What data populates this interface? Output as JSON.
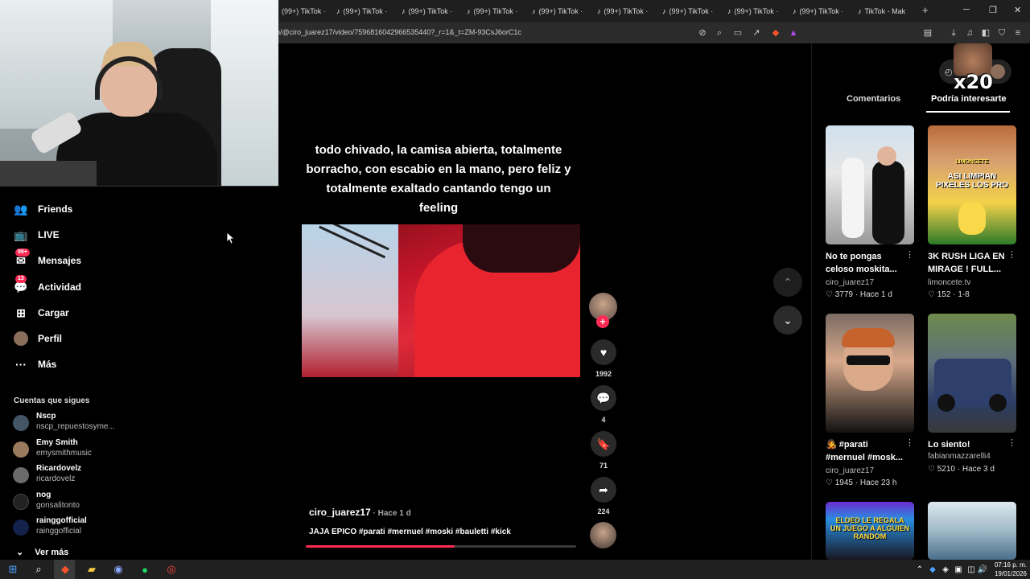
{
  "browser": {
    "tabs": [
      {
        "label": "(99+) TikTok ·"
      },
      {
        "label": "(99+) TikTok ·"
      },
      {
        "label": "(99+) TikTok ·"
      },
      {
        "label": "(99+) TikTok ·"
      },
      {
        "label": "(99+) TikTok ·"
      },
      {
        "label": "(99+) TikTok ·"
      },
      {
        "label": "(99+) TikTok ·"
      },
      {
        "label": "(99+) TikTok ·"
      },
      {
        "label": "(99+) TikTok ·"
      },
      {
        "label": "TikTok - Mak"
      }
    ],
    "url": "n/@ciro_juarez17/video/7596816042966535440?_r=1&_t=ZM-93CsJ6orC1c"
  },
  "sidebar": {
    "items": [
      {
        "label": "Friends",
        "icon": "friends-icon"
      },
      {
        "label": "LIVE",
        "icon": "live-icon"
      },
      {
        "label": "Mensajes",
        "icon": "messages-icon",
        "badge": "99+"
      },
      {
        "label": "Actividad",
        "icon": "activity-icon",
        "badge": "13"
      },
      {
        "label": "Cargar",
        "icon": "upload-icon"
      },
      {
        "label": "Perfil",
        "icon": "profile-avatar"
      },
      {
        "label": "Más",
        "icon": "more-icon"
      }
    ],
    "following_title": "Cuentas que sigues",
    "following": [
      {
        "name": "Nscp",
        "handle": "nscp_repuestosyme..."
      },
      {
        "name": "Emy Smith",
        "handle": "emysmithmusic"
      },
      {
        "name": "Ricardovelz",
        "handle": "ricardovelz"
      },
      {
        "name": "nog",
        "handle": "gonsalitonto"
      },
      {
        "name": "rainggofficial",
        "handle": "rainggofficial"
      }
    ],
    "see_more": "Ver más"
  },
  "video": {
    "caption": "todo chivado, la camisa abierta, totalmente borracho, con escabio en la mano, pero feliz y totalmente exaltado cantando tengo un feeling",
    "author": "ciro_juarez17",
    "time": " · Hace 1 d",
    "description": "JAJA EPICO #parati #mernuel #moski #bauletti #kick",
    "progress": 0.55,
    "likes": "1992",
    "comments": "4",
    "saves": "71",
    "shares": "224"
  },
  "right_panel": {
    "x20_label": "x20",
    "tabs": [
      {
        "label": "Comentarios"
      },
      {
        "label": "Podría interesarte"
      }
    ],
    "cards": [
      {
        "title": "No te pongas celoso moskita...",
        "author": "ciro_juarez17",
        "stats": "♡ 3779 · Hace 1 d",
        "thumb_text": ""
      },
      {
        "title": "3K RUSH LIGA EN MIRAGE ! FULL...",
        "author": "limoncete.tv",
        "stats": "♡ 152 · 1-8",
        "thumb_text": "ASI LIMPIAN PIXELES LOS PRO"
      },
      {
        "title": "🧑‍🎤 #parati #mernuel #mosk...",
        "author": "ciro_juarez17",
        "stats": "♡ 1945 · Hace 23 h",
        "thumb_text": ""
      },
      {
        "title": "Lo siento!",
        "author": "fabianmazzarelli4",
        "stats": "♡ 5210 · Hace 3 d",
        "thumb_text": ""
      },
      {
        "title": "",
        "author": "",
        "stats": "",
        "thumb_text": "ELDED LE REGALA UN JUEGO A ALGUIEN RANDOM"
      },
      {
        "title": "",
        "author": "",
        "stats": "",
        "thumb_text": ""
      }
    ],
    "thumb2_label": "LIMONCETE"
  },
  "taskbar": {
    "time": "07:16 p. m.",
    "date": "19/01/2026"
  }
}
